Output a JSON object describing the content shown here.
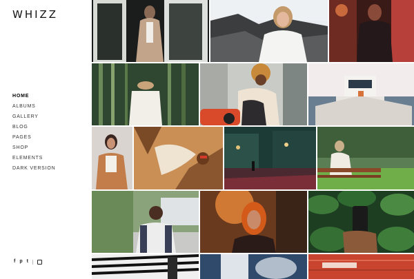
{
  "brand": {
    "logo": "WHIZZ"
  },
  "nav": {
    "items": [
      {
        "label": "HOME",
        "active": true
      },
      {
        "label": "ALBUMS"
      },
      {
        "label": "GALLERY"
      },
      {
        "label": "BLOG"
      },
      {
        "label": "PAGES"
      },
      {
        "label": "SHOP"
      },
      {
        "label": "ELEMENTS"
      },
      {
        "label": "DARK VERSION"
      }
    ]
  },
  "social": {
    "facebook": "f",
    "pinterest": "p",
    "twitter": "t"
  },
  "gallery": {
    "photos": [
      "woman-beige-coat-doorway",
      "woman-white-jacket-rocks",
      "woman-red-city-night",
      "person-hat-bamboo-forest",
      "mother-child-scooter",
      "boat-at-sea",
      "woman-white-top-wall",
      "person-sunlight-shadows",
      "city-street-night-rain",
      "woman-reading-bench",
      "man-eating-outdoors",
      "woman-sunset-portrait",
      "hand-phone-leaves",
      "striped-wall-person",
      "woman-smoke-blue",
      "red-wall-sign"
    ]
  }
}
